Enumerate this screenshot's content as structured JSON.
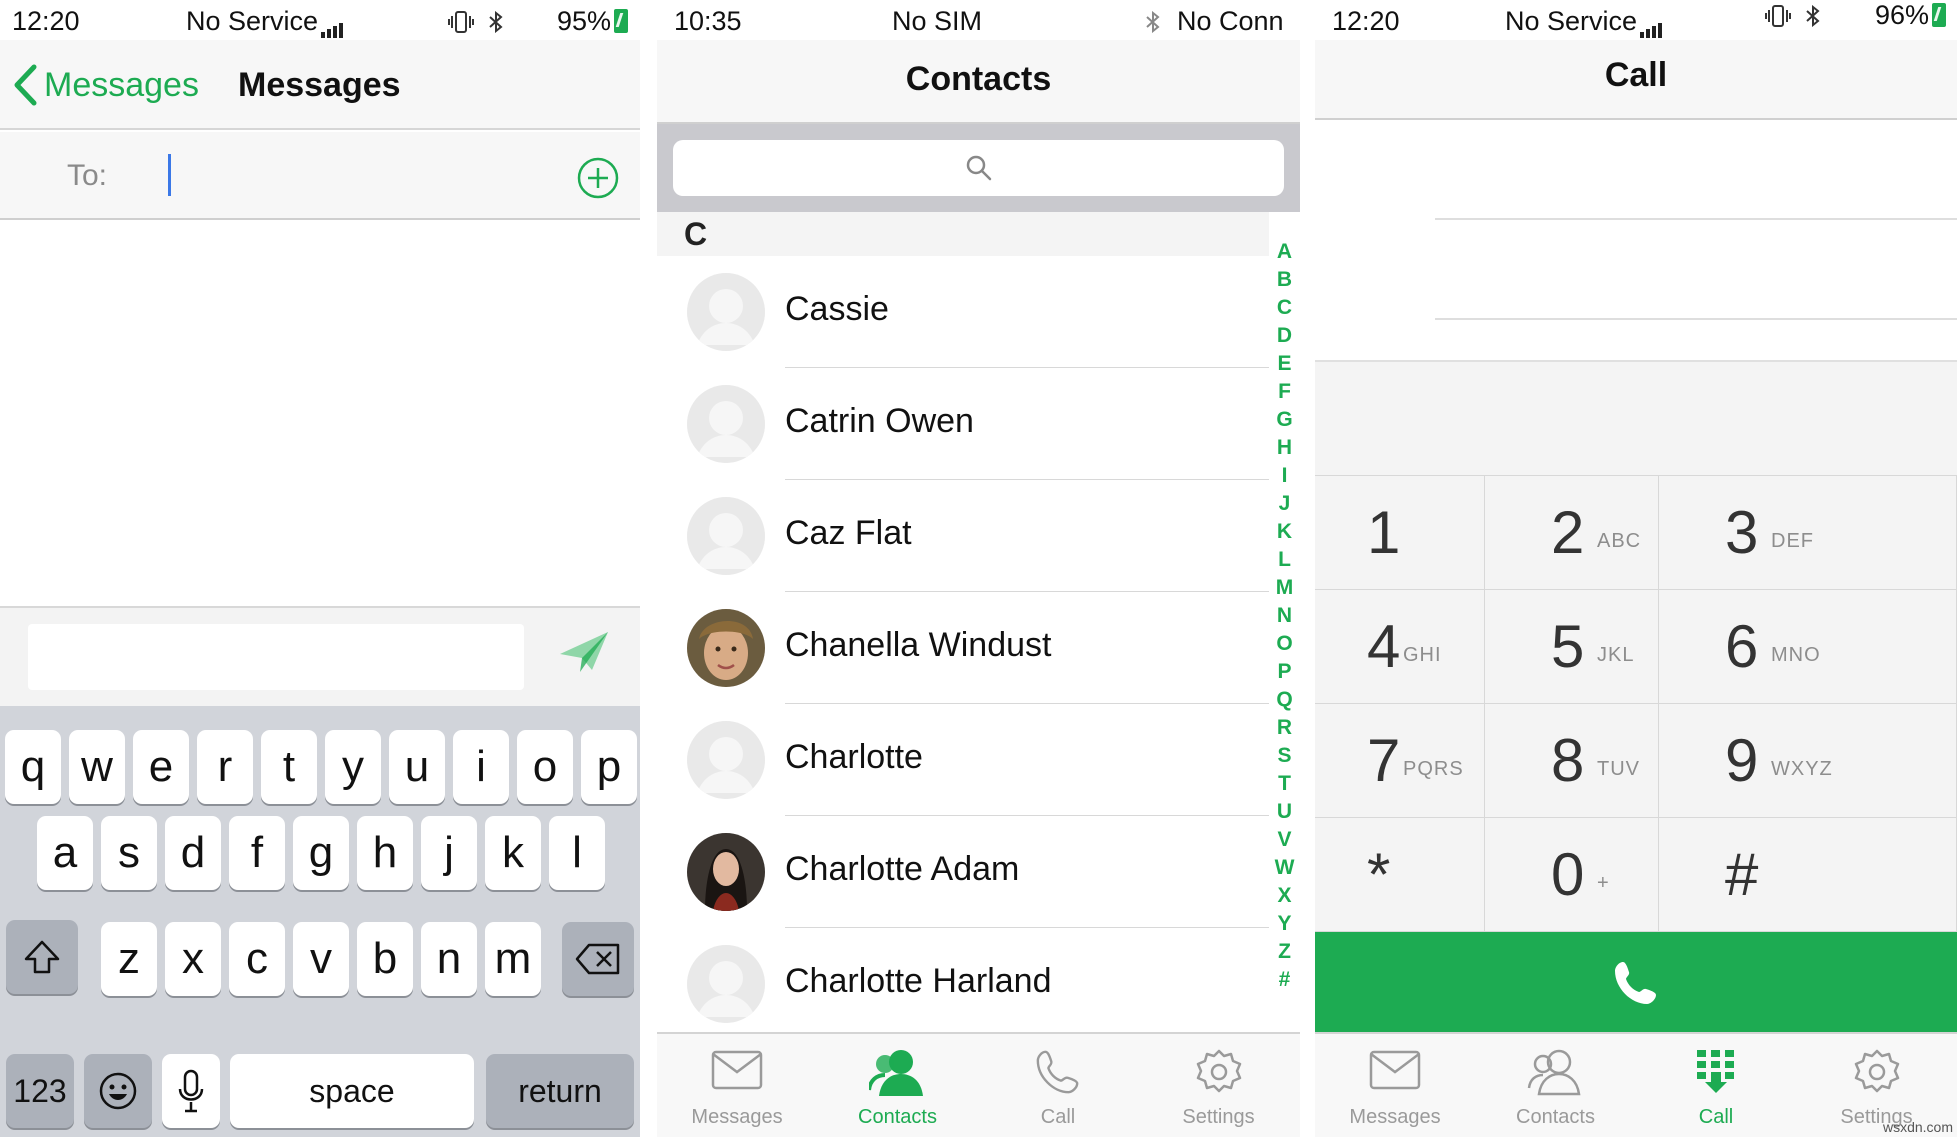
{
  "colors": {
    "accent": "#1dab52",
    "keyboard_bg": "#d1d4da"
  },
  "messages_screen": {
    "status": {
      "time": "12:20",
      "carrier": "No Service",
      "battery": "95%"
    },
    "back_label": "Messages",
    "title": "Messages",
    "to_label": "To:",
    "icons": {
      "back": "chevron-left-icon",
      "add_recipient": "plus-circle-icon",
      "send": "paper-plane-icon"
    },
    "keyboard": {
      "row1": [
        "q",
        "w",
        "e",
        "r",
        "t",
        "y",
        "u",
        "i",
        "o",
        "p"
      ],
      "row2": [
        "a",
        "s",
        "d",
        "f",
        "g",
        "h",
        "j",
        "k",
        "l"
      ],
      "row3": [
        "z",
        "x",
        "c",
        "v",
        "b",
        "n",
        "m"
      ],
      "numbers_key": "123",
      "space_key": "space",
      "return_key": "return"
    }
  },
  "contacts_screen": {
    "status": {
      "time": "10:35",
      "carrier": "No SIM",
      "connection": "No Conn"
    },
    "title": "Contacts",
    "section_header": "C",
    "contacts": [
      {
        "name": "Cassie",
        "avatar": "placeholder"
      },
      {
        "name": "Catrin Owen",
        "avatar": "placeholder"
      },
      {
        "name": "Caz Flat",
        "avatar": "placeholder"
      },
      {
        "name": "Chanella Windust",
        "avatar": "photo"
      },
      {
        "name": "Charlotte",
        "avatar": "placeholder"
      },
      {
        "name": "Charlotte Adam",
        "avatar": "photo"
      },
      {
        "name": "Charlotte Harland",
        "avatar": "placeholder"
      }
    ],
    "index_letters": [
      "A",
      "B",
      "C",
      "D",
      "E",
      "F",
      "G",
      "H",
      "I",
      "J",
      "K",
      "L",
      "M",
      "N",
      "O",
      "P",
      "Q",
      "R",
      "S",
      "T",
      "U",
      "V",
      "W",
      "X",
      "Y",
      "Z",
      "#"
    ],
    "tabs": [
      {
        "label": "Messages",
        "icon": "envelope-icon",
        "active": false
      },
      {
        "label": "Contacts",
        "icon": "contacts-icon",
        "active": true
      },
      {
        "label": "Call",
        "icon": "phone-icon",
        "active": false
      },
      {
        "label": "Settings",
        "icon": "gear-icon",
        "active": false
      }
    ]
  },
  "call_screen": {
    "status": {
      "time": "12:20",
      "carrier": "No Service",
      "battery": "96%"
    },
    "title": "Call",
    "keys": [
      {
        "digit": "1",
        "letters": ""
      },
      {
        "digit": "2",
        "letters": "ABC"
      },
      {
        "digit": "3",
        "letters": "DEF"
      },
      {
        "digit": "4",
        "letters": "GHI"
      },
      {
        "digit": "5",
        "letters": "JKL"
      },
      {
        "digit": "6",
        "letters": "MNO"
      },
      {
        "digit": "7",
        "letters": "PQRS"
      },
      {
        "digit": "8",
        "letters": "TUV"
      },
      {
        "digit": "9",
        "letters": "WXYZ"
      },
      {
        "digit": "*",
        "letters": ""
      },
      {
        "digit": "0",
        "letters": "+"
      },
      {
        "digit": "#",
        "letters": ""
      }
    ],
    "call_icon": "phone-icon",
    "tabs": [
      {
        "label": "Messages",
        "icon": "envelope-icon",
        "active": false
      },
      {
        "label": "Contacts",
        "icon": "contacts-icon",
        "active": false
      },
      {
        "label": "Call",
        "icon": "dialpad-icon",
        "active": true
      },
      {
        "label": "Settings",
        "icon": "gear-icon",
        "active": false
      }
    ]
  },
  "watermark": "wsxdn.com"
}
